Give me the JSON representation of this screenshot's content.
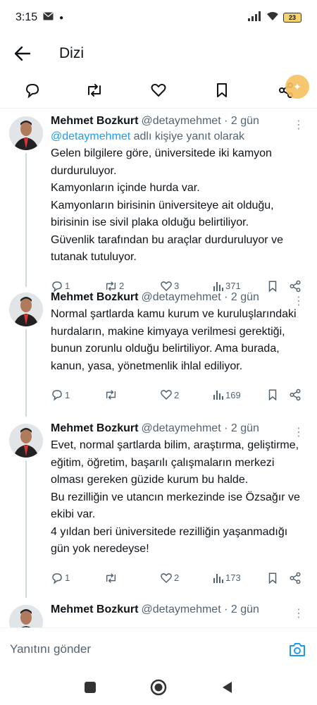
{
  "status_bar": {
    "time": "3:15",
    "battery": "23"
  },
  "header": {
    "title": "Dizi"
  },
  "tweets": [
    {
      "name": "Mehmet Bozkurt",
      "handle": "@detaymehmet · 2 gün",
      "reply_mention": "@detaymehmet",
      "reply_suffix": " adlı kişiye yanıt olarak",
      "text": "Gelen bilgilere göre, üniversitede iki kamyon durduruluyor.\nKamyonların içinde hurda var.\nKamyonların birisinin üniversiteye ait olduğu, birisinin ise sivil plaka olduğu belirtiliyor.\nGüvenlik tarafından bu araçlar durduruluyor ve tutanak tutuluyor.",
      "replies": "1",
      "retweets": "2",
      "likes": "3",
      "views": "371"
    },
    {
      "name": "Mehmet Bozkurt",
      "handle": "@detaymehmet · 2 gün",
      "text": "Normal şartlarda kamu kurum ve kuruluşlarındaki hurdaların, makine kimyaya verilmesi gerektiği, bunun zorunlu olduğu belirtiliyor. Ama burada, kanun, yasa, yönetmenlik ihlal ediliyor.",
      "replies": "1",
      "retweets": "",
      "likes": "2",
      "views": "169"
    },
    {
      "name": "Mehmet Bozkurt",
      "handle": "@detaymehmet · 2 gün",
      "text": "Evet, normal şartlarda bilim, araştırma, geliştirme, eğitim, öğretim, başarılı çalışmaların merkezi olması gereken güzide kurum bu halde.\nBu rezilliğin ve utancın merkezinde ise Özsağır ve ekibi var.\n4 yıldan beri üniversitede rezilliğin yaşanmadığı gün yok neredeyse!",
      "replies": "1",
      "retweets": "",
      "likes": "2",
      "views": "173"
    },
    {
      "name": "Mehmet Bozkurt",
      "handle": "@detaymehmet · 2 gün"
    }
  ],
  "reply_bar": {
    "placeholder": "Yanıtını gönder"
  },
  "icons": {
    "back": "arrow-left-icon",
    "reply": "speech-bubble-icon",
    "retweet": "retweet-arrows-icon",
    "like": "heart-icon",
    "bookmark": "bookmark-icon",
    "share": "share-icon",
    "views": "bar-chart-icon",
    "camera": "camera-icon"
  },
  "colors": {
    "accent": "#1d9bf0",
    "secondary_text": "#536471",
    "fab": "#f6c15f"
  }
}
